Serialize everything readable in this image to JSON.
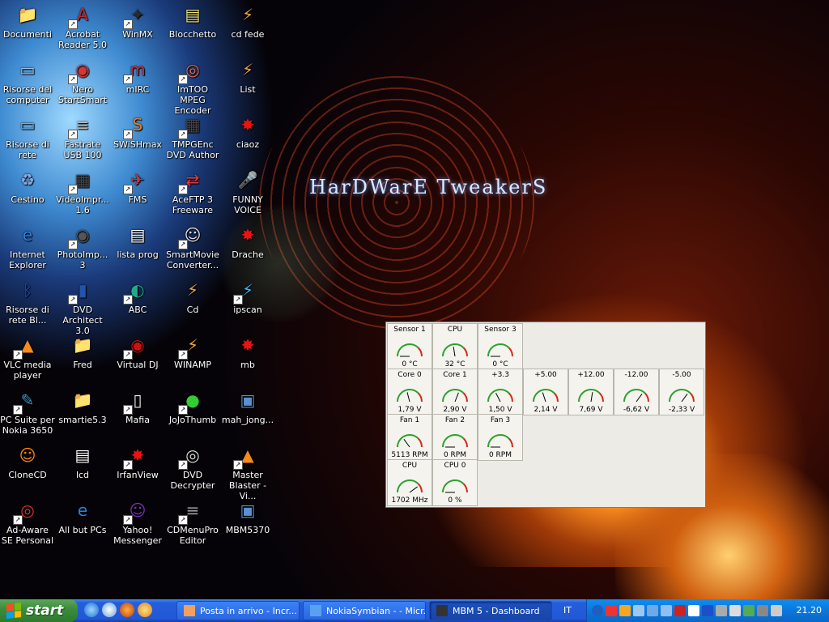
{
  "desktop": {
    "wallpaper_brand": "HarDWarE TweakerS",
    "icons": [
      {
        "label": "Documenti",
        "icon": "folder-icon",
        "shortcut": false
      },
      {
        "label": "Acrobat Reader 5.0",
        "icon": "acrobat-icon",
        "shortcut": true
      },
      {
        "label": "WinMX",
        "icon": "winmx-icon",
        "shortcut": true
      },
      {
        "label": "Blocchetto",
        "icon": "notepad-icon",
        "shortcut": false
      },
      {
        "label": "cd fede",
        "icon": "winamp-playlist-icon",
        "shortcut": false
      },
      {
        "label": "Risorse del computer",
        "icon": "computer-icon",
        "shortcut": false
      },
      {
        "label": "Nero StartSmart",
        "icon": "nero-icon",
        "shortcut": true
      },
      {
        "label": "mIRC",
        "icon": "mirc-icon",
        "shortcut": true
      },
      {
        "label": "ImTOO MPEG Encoder",
        "icon": "encoder-icon",
        "shortcut": true
      },
      {
        "label": "List",
        "icon": "winamp-playlist-icon",
        "shortcut": false
      },
      {
        "label": "Risorse di rete",
        "icon": "network-icon",
        "shortcut": false
      },
      {
        "label": "Fastrate USB 100",
        "icon": "modem-icon",
        "shortcut": true
      },
      {
        "label": "SWiSHmax",
        "icon": "swish-icon",
        "shortcut": true
      },
      {
        "label": "TMPGEnc DVD Author",
        "icon": "film-icon",
        "shortcut": true
      },
      {
        "label": "ciaoz",
        "icon": "splash-icon",
        "shortcut": false
      },
      {
        "label": "Cestino",
        "icon": "recycle-bin-icon",
        "shortcut": false
      },
      {
        "label": "VideoImpr... 1.6",
        "icon": "film-icon",
        "shortcut": true
      },
      {
        "label": "FMS",
        "icon": "plane-icon",
        "shortcut": true
      },
      {
        "label": "AceFTP 3 Freeware",
        "icon": "ftp-icon",
        "shortcut": true
      },
      {
        "label": "FUNNY VOICE",
        "icon": "microphone-icon",
        "shortcut": false
      },
      {
        "label": "Internet Explorer",
        "icon": "ie-icon",
        "shortcut": false
      },
      {
        "label": "PhotoImp... 3",
        "icon": "photo-icon",
        "shortcut": true
      },
      {
        "label": "lista prog",
        "icon": "text-file-icon",
        "shortcut": false
      },
      {
        "label": "SmartMovie Converter...",
        "icon": "masks-icon",
        "shortcut": true
      },
      {
        "label": "Drache",
        "icon": "splash-icon",
        "shortcut": false
      },
      {
        "label": "Risorse di rete Bl...",
        "icon": "bluetooth-icon",
        "shortcut": false
      },
      {
        "label": "DVD Architect 3.0",
        "icon": "dvd-architect-icon",
        "shortcut": true
      },
      {
        "label": "ABC",
        "icon": "abc-icon",
        "shortcut": true
      },
      {
        "label": "Cd",
        "icon": "winamp-playlist-icon",
        "shortcut": false
      },
      {
        "label": "ipscan",
        "icon": "ipscan-icon",
        "shortcut": true
      },
      {
        "label": "VLC media player",
        "icon": "vlc-cone-icon",
        "shortcut": true
      },
      {
        "label": "Fred",
        "icon": "folder-icon",
        "shortcut": false
      },
      {
        "label": "Virtual DJ",
        "icon": "virtual-dj-icon",
        "shortcut": true
      },
      {
        "label": "WINAMP",
        "icon": "winamp-icon",
        "shortcut": true
      },
      {
        "label": "mb",
        "icon": "splash-icon",
        "shortcut": false
      },
      {
        "label": "PC Suite per Nokia 3650",
        "icon": "nokia-suite-icon",
        "shortcut": true
      },
      {
        "label": "smartie5.3",
        "icon": "folder-icon",
        "shortcut": false
      },
      {
        "label": "Mafia",
        "icon": "mafia-icon",
        "shortcut": true
      },
      {
        "label": "JoJoThumb",
        "icon": "color-balls-icon",
        "shortcut": true
      },
      {
        "label": "mah_jong...",
        "icon": "setup-icon",
        "shortcut": false
      },
      {
        "label": "CloneCD",
        "icon": "clonecd-icon",
        "shortcut": false
      },
      {
        "label": "lcd",
        "icon": "text-file-icon",
        "shortcut": false
      },
      {
        "label": "IrfanView",
        "icon": "splash-icon",
        "shortcut": true
      },
      {
        "label": "DVD Decrypter",
        "icon": "dvd-icon",
        "shortcut": true
      },
      {
        "label": "Master Blaster - Vi...",
        "icon": "vlc-cone-icon",
        "shortcut": true
      },
      {
        "label": "Ad-Aware SE Personal",
        "icon": "adaware-icon",
        "shortcut": true
      },
      {
        "label": "All but PCs",
        "icon": "ie-page-icon",
        "shortcut": false
      },
      {
        "label": "Yahoo! Messenger",
        "icon": "yahoo-icon",
        "shortcut": true
      },
      {
        "label": "CDMenuPro Editor",
        "icon": "cdmenu-icon",
        "shortcut": true
      },
      {
        "label": "MBM5370",
        "icon": "setup-icon",
        "shortcut": false
      }
    ]
  },
  "dashboard": {
    "gauges": [
      {
        "label": "Sensor 1",
        "value": "0 °C",
        "level": 0.0
      },
      {
        "label": "CPU",
        "value": "32 °C",
        "level": 0.45
      },
      {
        "label": "Sensor 3",
        "value": "0 °C",
        "level": 0.0
      },
      {
        "label": "Core 0",
        "value": "1,79 V",
        "level": 0.42
      },
      {
        "label": "Core 1",
        "value": "2,90 V",
        "level": 0.62
      },
      {
        "label": "+3.3",
        "value": "1,50 V",
        "level": 0.35
      },
      {
        "label": "+5.00",
        "value": "2,14 V",
        "level": 0.4
      },
      {
        "label": "+12.00",
        "value": "7,69 V",
        "level": 0.55
      },
      {
        "label": "-12.00",
        "value": "-6,62 V",
        "level": 0.7
      },
      {
        "label": "-5.00",
        "value": "-2,33 V",
        "level": 0.7
      },
      {
        "label": "Fan 1",
        "value": "5113 RPM",
        "level": 0.3
      },
      {
        "label": "Fan 2",
        "value": "0 RPM",
        "level": 0.0
      },
      {
        "label": "Fan 3",
        "value": "0 RPM",
        "level": 0.0
      },
      {
        "label": "CPU",
        "value": "1702 MHz",
        "level": 0.8
      },
      {
        "label": "CPU 0",
        "value": "0 %",
        "level": 0.0
      }
    ]
  },
  "taskbar": {
    "start_label": "start",
    "quick_launch": [
      "ie-icon",
      "outlook-express-icon",
      "firefox-icon",
      "media-player-icon"
    ],
    "tasks": [
      {
        "label": "Posta in arrivo - Incr...",
        "icon": "mail-icon",
        "active": false
      },
      {
        "label": "NokiaSymbian - - Micr...",
        "icon": "ie-page-icon",
        "active": false
      },
      {
        "label": "MBM 5 - Dashboard",
        "icon": "chip-icon",
        "active": true
      }
    ],
    "language": "IT",
    "clock": "21.20"
  },
  "colors": {
    "gauge_green": "#2fa12f",
    "gauge_red": "#d42a1c",
    "taskbar_blue": "#245edc",
    "start_green": "#3c8d3c",
    "tray_blue": "#0b77dc"
  }
}
